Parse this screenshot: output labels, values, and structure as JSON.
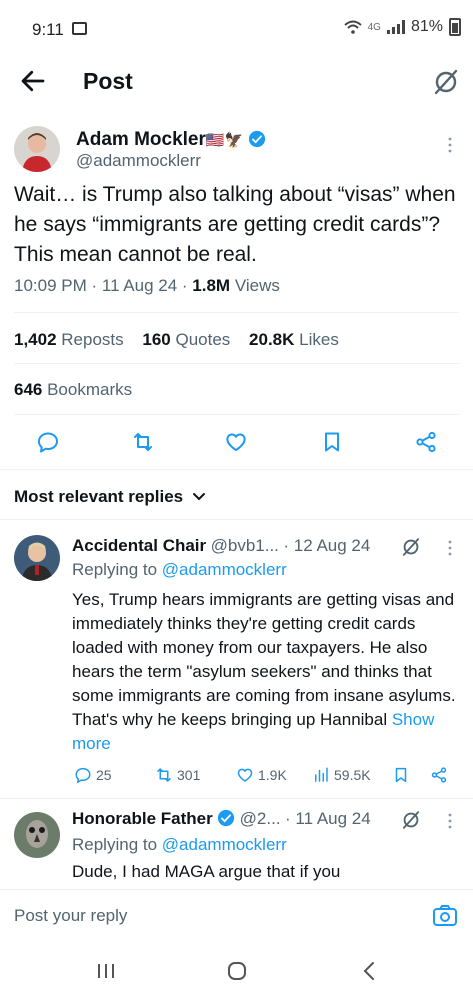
{
  "status_bar": {
    "time": "9:11",
    "network": "4G",
    "battery": "81%"
  },
  "header": {
    "title": "Post"
  },
  "main_post": {
    "author_name": "Adam Mockler",
    "author_flags": "🇺🇸🦅",
    "handle": "@adammocklerr",
    "text": "Wait… is Trump also talking about “visas” when he says “immigrants are getting credit cards”? This mean cannot be real.",
    "time": "10:09 PM · 11 Aug 24 · ",
    "views_count": "1.8M",
    "views_label": " Views",
    "reposts_count": "1,402",
    "reposts_label": " Reposts",
    "quotes_count": "160",
    "quotes_label": " Quotes",
    "likes_count": "20.8K",
    "likes_label": " Likes",
    "bookmarks_count": "646",
    "bookmarks_label": " Bookmarks"
  },
  "replies_filter": {
    "label": "Most relevant replies"
  },
  "replies": [
    {
      "name": "Accidental Chair",
      "handle": "@bvb1...",
      "date": "· 12 Aug 24",
      "replying_prefix": "Replying to ",
      "replying_to": "@adammocklerr",
      "text": "Yes, Trump hears immigrants are getting visas and immediately thinks they're getting credit cards loaded with money from our taxpayers. He also hears the term \"asylum seekers\" and thinks that some immigrants are coming from insane asylums. That's why he keeps bringing up Hannibal ",
      "show_more": "Show more",
      "replies_count": "25",
      "reposts_count": "301",
      "likes_count": "1.9K",
      "views_count": "59.5K"
    },
    {
      "name": "Honorable Father",
      "handle": "@2...",
      "date": "· 11 Aug 24",
      "replying_prefix": "Replying to ",
      "replying_to": "@adammocklerr",
      "text": "Dude, I had MAGA argue that if you"
    }
  ],
  "composer": {
    "placeholder": "Post your reply"
  },
  "colors": {
    "accent": "#1d9bf0",
    "muted": "#536471",
    "text": "#0f1419"
  },
  "icons": [
    "back-arrow-icon",
    "grok-icon",
    "verified-badge-icon",
    "more-icon",
    "reply-icon",
    "repost-icon",
    "like-icon",
    "bookmark-icon",
    "share-icon",
    "chevron-down-icon",
    "views-icon",
    "camera-icon",
    "recent-apps-icon",
    "home-icon",
    "back-nav-icon"
  ]
}
